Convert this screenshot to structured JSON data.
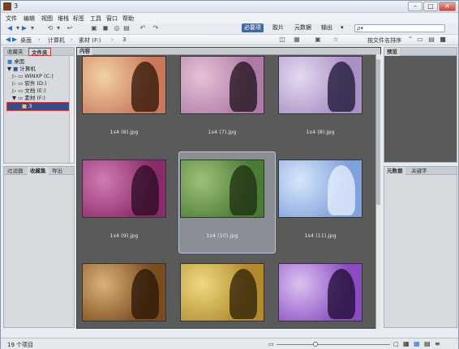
{
  "window": {
    "title": "3",
    "minimize": "–",
    "maximize": "□",
    "close": "✕"
  },
  "menu": [
    "文件",
    "编辑",
    "视图",
    "堆栈",
    "标签",
    "工具",
    "窗口",
    "帮助"
  ],
  "workspaces": [
    "必要项",
    "胶片",
    "元数据",
    "输出"
  ],
  "search": {
    "placeholder": "ρ▾"
  },
  "path": {
    "items": [
      "桌面",
      "计算机",
      "素材 (F:)",
      "3"
    ]
  },
  "sort": {
    "label": "按文件名排序"
  },
  "left_panel": {
    "tabs": [
      "收藏夹",
      "文件夹"
    ],
    "tree": [
      {
        "label": "桌面"
      },
      {
        "label": "计算机"
      },
      {
        "label": "WINXP (C:)"
      },
      {
        "label": "软件 (D:)"
      },
      {
        "label": "文档 (E:)"
      },
      {
        "label": "素材 (F:)"
      },
      {
        "label": "3"
      }
    ],
    "bottom_tabs": [
      "过滤器",
      "收藏集",
      "导出"
    ]
  },
  "content": {
    "tab": "内容",
    "items": [
      {
        "name": "1s4 (6).jpg",
        "c1": "#f2d1a6",
        "c2": "#c9785a",
        "accent": "#2b1406"
      },
      {
        "name": "1s4 (7).jpg",
        "c1": "#e6c2d6",
        "c2": "#b07aa7",
        "accent": "#1a0f18"
      },
      {
        "name": "1s4 (8).jpg",
        "c1": "#e5d9ef",
        "c2": "#a88fc6",
        "accent": "#1a1230"
      },
      {
        "name": "1s4 (9).jpg",
        "c1": "#d07cb1",
        "c2": "#8a2a6a",
        "accent": "#2a0b22"
      },
      {
        "name": "1s4 (10).jpg",
        "c1": "#9fc07a",
        "c2": "#4b7b35",
        "accent": "#1d2e12"
      },
      {
        "name": "1s4 (11).jpg",
        "c1": "#d8e6fb",
        "c2": "#7fa2db",
        "accent": "#e9f1ff"
      },
      {
        "name": "",
        "c1": "#d9b27a",
        "c2": "#7a4b1c",
        "accent": "#2a1607"
      },
      {
        "name": "",
        "c1": "#f0d980",
        "c2": "#b08a2c",
        "accent": "#2a1f07"
      },
      {
        "name": "",
        "c1": "#dbc3f0",
        "c2": "#8b4bc3",
        "accent": "#1b0b2d"
      }
    ]
  },
  "right_panel": {
    "tab": "预览",
    "bottom_tabs": [
      "元数据",
      "关键字"
    ]
  },
  "status": {
    "text": "19 个项目"
  }
}
